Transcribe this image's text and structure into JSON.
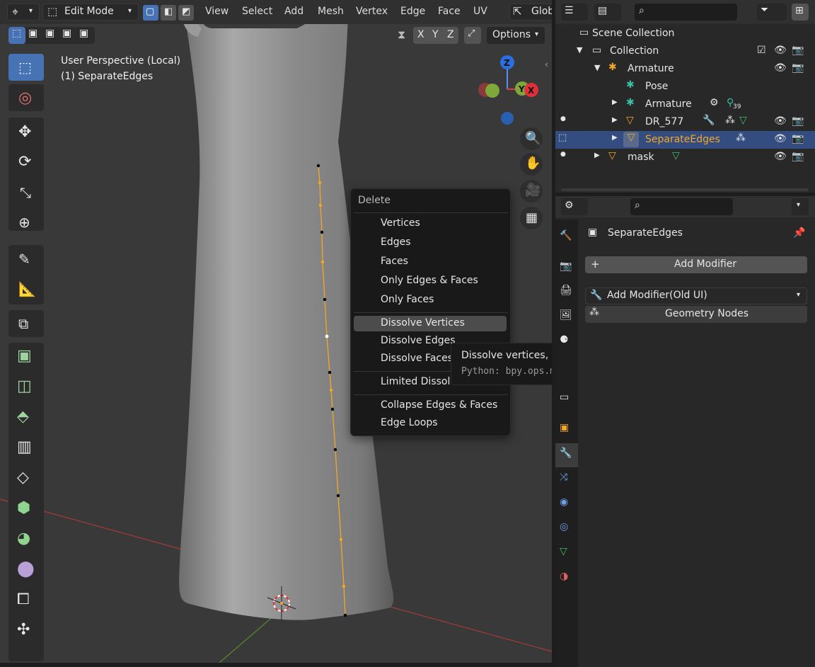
{
  "header": {
    "mode_label": "Edit Mode",
    "menus": [
      "View",
      "Select",
      "Add",
      "Mesh",
      "Vertex",
      "Edge",
      "Face",
      "UV"
    ],
    "transform_orientation": "Glob",
    "axes": [
      "X",
      "Y",
      "Z"
    ],
    "options_label": "Options"
  },
  "viewport": {
    "perspective_label": "User Perspective (Local)",
    "object_label": "(1) SeparateEdges",
    "gizmo": {
      "z_label": "Z",
      "y_label": "Y",
      "x_label": "X"
    }
  },
  "delete_menu": {
    "title": "Delete",
    "items": [
      "Vertices",
      "Edges",
      "Faces",
      "Only Edges & Faces",
      "Only Faces",
      "Dissolve Vertices",
      "Dissolve Edges",
      "Dissolve Faces",
      "Limited Dissolve",
      "Collapse Edges & Faces",
      "Edge Loops"
    ],
    "highlighted": "Dissolve Vertices"
  },
  "tooltip": {
    "description": "Dissolve vertices, merge edges and faces.",
    "python": "Python: bpy.ops.mesh.dissolve_verts()"
  },
  "outliner": {
    "rows": [
      {
        "label": "Scene Collection"
      },
      {
        "label": "Collection"
      },
      {
        "label": "Armature"
      },
      {
        "label": "Pose"
      },
      {
        "label": "Armature",
        "badge": "39"
      },
      {
        "label": "DR_577"
      },
      {
        "label": "SeparateEdges"
      },
      {
        "label": "mask"
      }
    ]
  },
  "properties": {
    "object_name": "SeparateEdges",
    "add_modifier_label": "Add Modifier",
    "add_modifier_old_label": "Add Modifier(Old UI)",
    "geometry_nodes_label": "Geometry Nodes"
  },
  "colors": {
    "accent_blue": "#4772b3",
    "selection_orange": "#f5a623",
    "bg_dark": "#1d1d1d"
  }
}
